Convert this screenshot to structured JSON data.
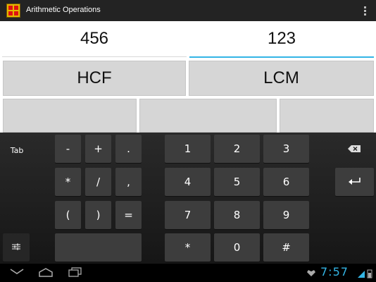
{
  "app": {
    "title": "Arithmetic Operations",
    "icon": "grid-app-icon"
  },
  "inputs": {
    "first_value": "456",
    "second_value": "123"
  },
  "buttons": {
    "hcf_label": "HCF",
    "lcm_label": "LCM"
  },
  "keyboard": {
    "tab": "Tab",
    "symbols": [
      "-",
      "+",
      ".",
      "*",
      "/",
      ",",
      "(",
      ")",
      "="
    ],
    "digits": [
      "1",
      "2",
      "3",
      "4",
      "5",
      "6",
      "7",
      "8",
      "9"
    ],
    "bottom": [
      "*",
      "0",
      "#"
    ]
  },
  "status": {
    "time": "7:57"
  },
  "colors": {
    "accent": "#33b5e5",
    "button_bg": "#d6d6d6",
    "key_bg": "#3d3d3d"
  }
}
